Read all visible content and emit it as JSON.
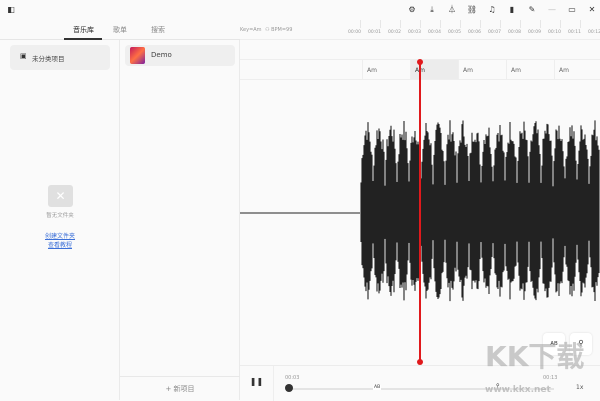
{
  "topbar": {
    "icons": [
      "sidebar-toggle-icon",
      "settings-icon",
      "download-icon",
      "metronome-icon",
      "link-icon",
      "music-note-icon",
      "bookmark-icon",
      "pin-icon",
      "minimize-icon",
      "maximize-icon",
      "close-icon"
    ]
  },
  "tabs": [
    {
      "label": "音乐库"
    },
    {
      "label": "歌单"
    },
    {
      "label": "搜索"
    }
  ],
  "left": {
    "folder_item": "未分类项目",
    "empty_text": "暂无文件夹",
    "create_link": "创建文件夹",
    "tutorial_link": "查看教程"
  },
  "middle": {
    "project": "Demo",
    "new_project": "+ 新项目"
  },
  "editor": {
    "key_info": "Key=Am",
    "bpm_info": "BPM=99",
    "timeline": [
      "00:00",
      "00:01",
      "00:02",
      "00:03",
      "00:04",
      "00:05",
      "00:06",
      "00:07",
      "00:08",
      "00:09",
      "00:10",
      "00:11",
      "00:12"
    ],
    "chords": [
      "Am",
      "Am",
      "Am",
      "Am",
      "Am"
    ],
    "active_chord": 1,
    "playhead_time_sec": 3.4,
    "colors": {
      "playhead": "#e0191c",
      "waveform": "#222222"
    }
  },
  "player": {
    "current_time": "00:03",
    "total_time": "00:13",
    "ab_label": "AB",
    "speed": "1x",
    "progress": 0.0,
    "float_ab": "AB"
  },
  "watermark": {
    "text": "KK下载",
    "url": "www.kkx.net"
  }
}
